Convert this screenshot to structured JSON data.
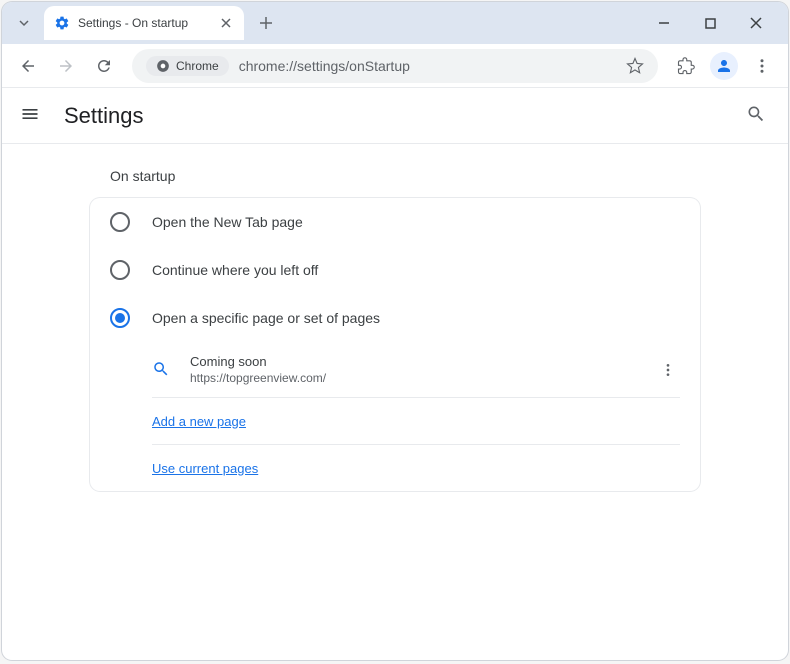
{
  "tab": {
    "title": "Settings - On startup"
  },
  "omnibox": {
    "chip": "Chrome",
    "url": "chrome://settings/onStartup"
  },
  "settings": {
    "title": "Settings"
  },
  "section": {
    "title": "On startup"
  },
  "radios": {
    "newtab": "Open the New Tab page",
    "continue": "Continue where you left off",
    "specific": "Open a specific page or set of pages"
  },
  "page": {
    "title": "Coming soon",
    "url": "https://topgreenview.com/"
  },
  "actions": {
    "add": "Add a new page",
    "current": "Use current pages"
  }
}
